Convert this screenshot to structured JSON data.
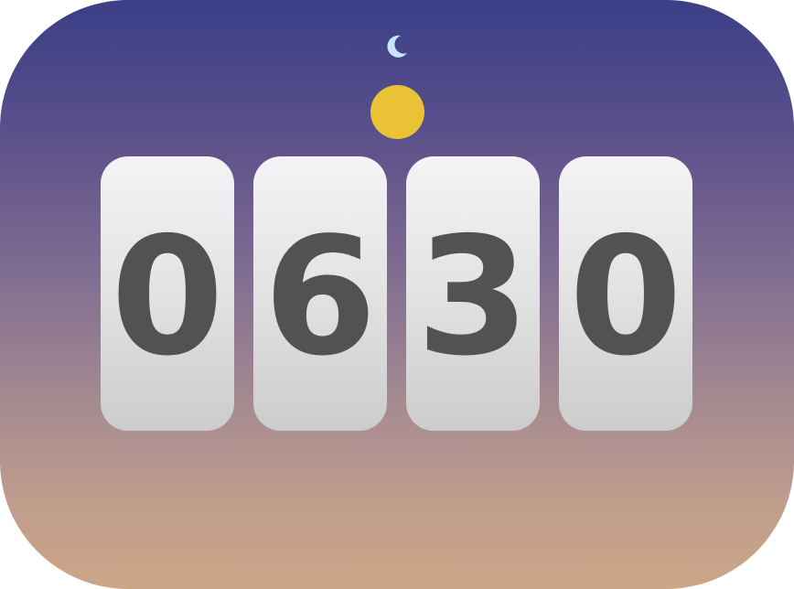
{
  "clock": {
    "digits": [
      "0",
      "6",
      "3",
      "0"
    ]
  },
  "icons": {
    "moon": "crescent-moon",
    "sun": "sun-disc"
  },
  "colors": {
    "sky_top": "#3a3f87",
    "sky_bottom": "#cca686",
    "sun": "#e9c335",
    "moon": "#c9e6f8",
    "digit_text": "#525252"
  }
}
